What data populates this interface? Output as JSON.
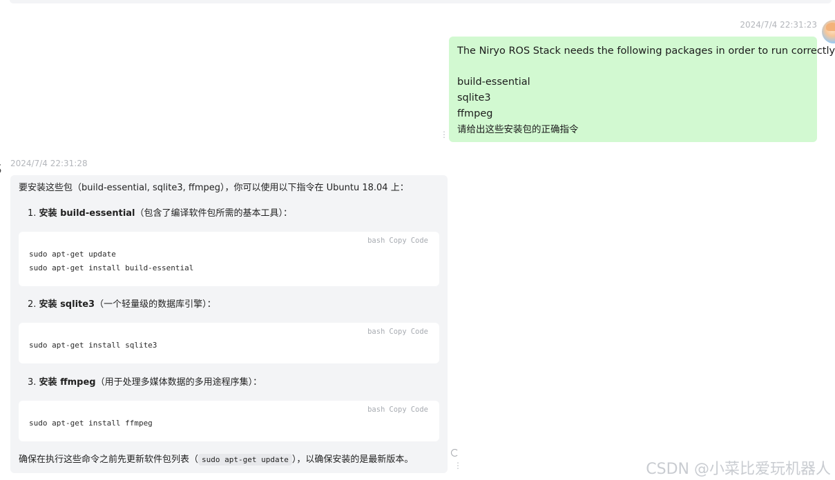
{
  "user_message": {
    "timestamp": "2024/7/4 22:31:23",
    "lines": [
      "The Niryo ROS Stack needs the following packages in order to run correctly:",
      "",
      "build-essential",
      "sqlite3",
      "ffmpeg",
      "请给出这些安装包的正确指令"
    ]
  },
  "assistant_message": {
    "timestamp": "2024/7/4 22:31:28",
    "intro": "要安装这些包（build-essential, sqlite3, ffmpeg），你可以使用以下指令在 Ubuntu 18.04 上：",
    "code_toolbar": {
      "lang": "bash",
      "copy": "Copy",
      "code": "Code"
    },
    "steps": [
      {
        "number": "1.",
        "title": "安装 build-essential",
        "desc": "（包含了编译软件包所需的基本工具）：",
        "code": [
          "sudo apt-get update",
          "sudo apt-get install build-essential"
        ]
      },
      {
        "number": "2.",
        "title": "安装 sqlite3",
        "desc": "（一个轻量级的数据库引擎）：",
        "code": [
          "sudo apt-get install sqlite3"
        ]
      },
      {
        "number": "3.",
        "title": "安装 ffmpeg",
        "desc": "（用于处理多媒体数据的多用途程序集）：",
        "code": [
          "sudo apt-get install ffmpeg"
        ]
      }
    ],
    "outro_before": "确保在执行这些命令之前先更新软件包列表（",
    "outro_code": "sudo apt-get update",
    "outro_after": "），以确保安装的是最新版本。"
  },
  "watermark": "CSDN @小菜比爱玩机器人"
}
